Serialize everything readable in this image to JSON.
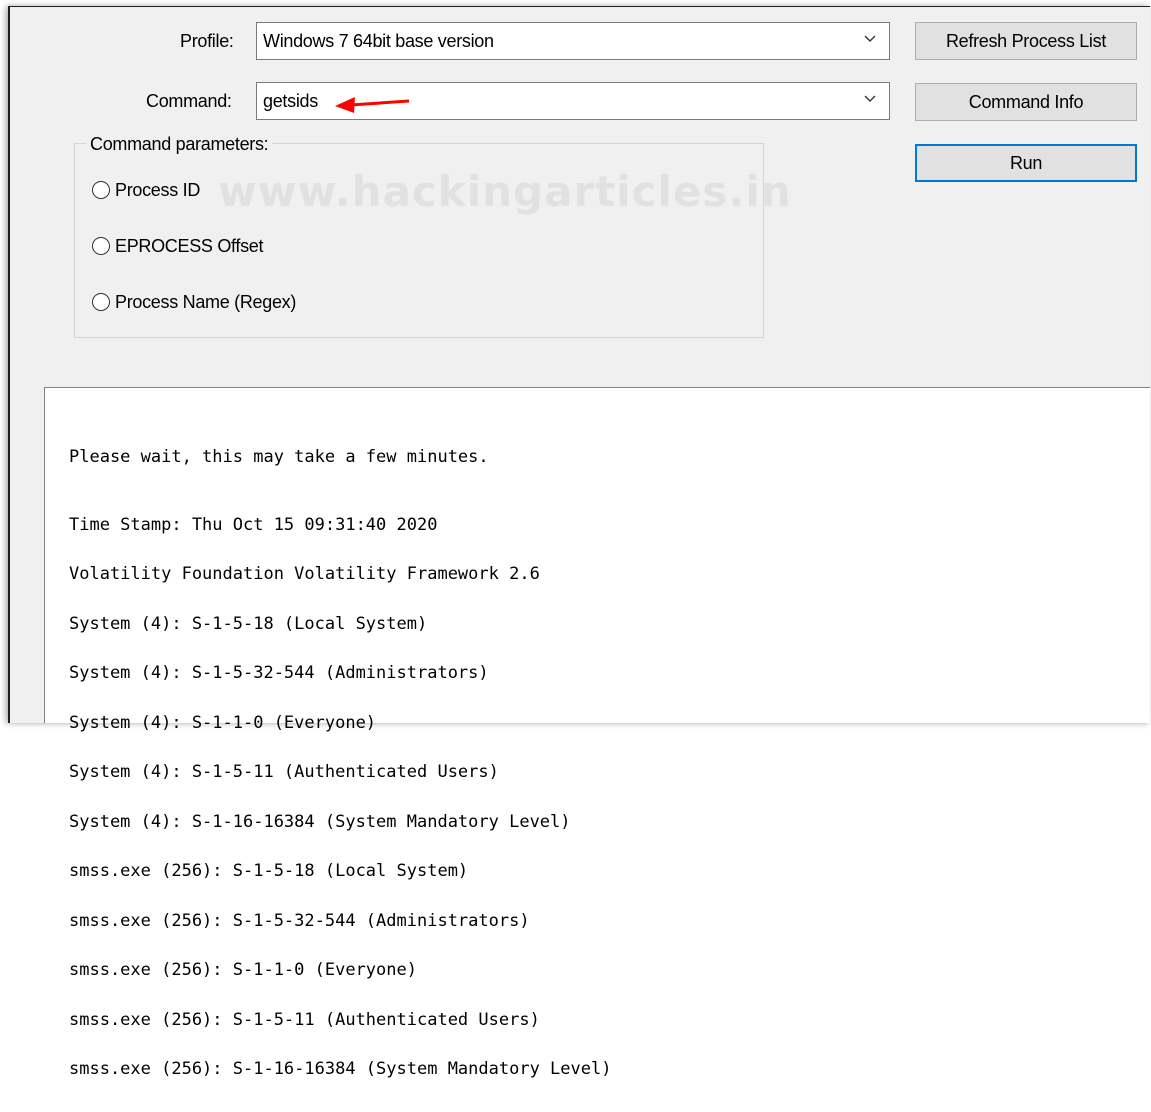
{
  "form": {
    "profile_label": "Profile:",
    "profile_value": "Windows 7 64bit base version",
    "command_label": "Command:",
    "command_value": "getsids",
    "params_title": "Command parameters:",
    "radios": [
      "Process ID",
      "EPROCESS Offset",
      "Process Name (Regex)"
    ]
  },
  "buttons": {
    "refresh": "Refresh Process List",
    "command_info": "Command Info",
    "run": "Run"
  },
  "watermark": "www.hackingarticles.in",
  "output": {
    "lines": [
      "Please wait, this may take a few minutes.",
      "Time Stamp: Thu Oct 15 09:31:40 2020",
      "Volatility Foundation Volatility Framework 2.6",
      "System (4): S-1-5-18 (Local System)",
      "System (4): S-1-5-32-544 (Administrators)",
      "System (4): S-1-1-0 (Everyone)",
      "System (4): S-1-5-11 (Authenticated Users)",
      "System (4): S-1-16-16384 (System Mandatory Level)",
      "smss.exe (256): S-1-5-18 (Local System)",
      "smss.exe (256): S-1-5-32-544 (Administrators)",
      "smss.exe (256): S-1-1-0 (Everyone)",
      "smss.exe (256): S-1-5-11 (Authenticated Users)",
      "smss.exe (256): S-1-16-16384 (System Mandatory Level)"
    ]
  },
  "colors": {
    "annotation_arrow": "#ff0000",
    "default_button_border": "#0078d7"
  }
}
